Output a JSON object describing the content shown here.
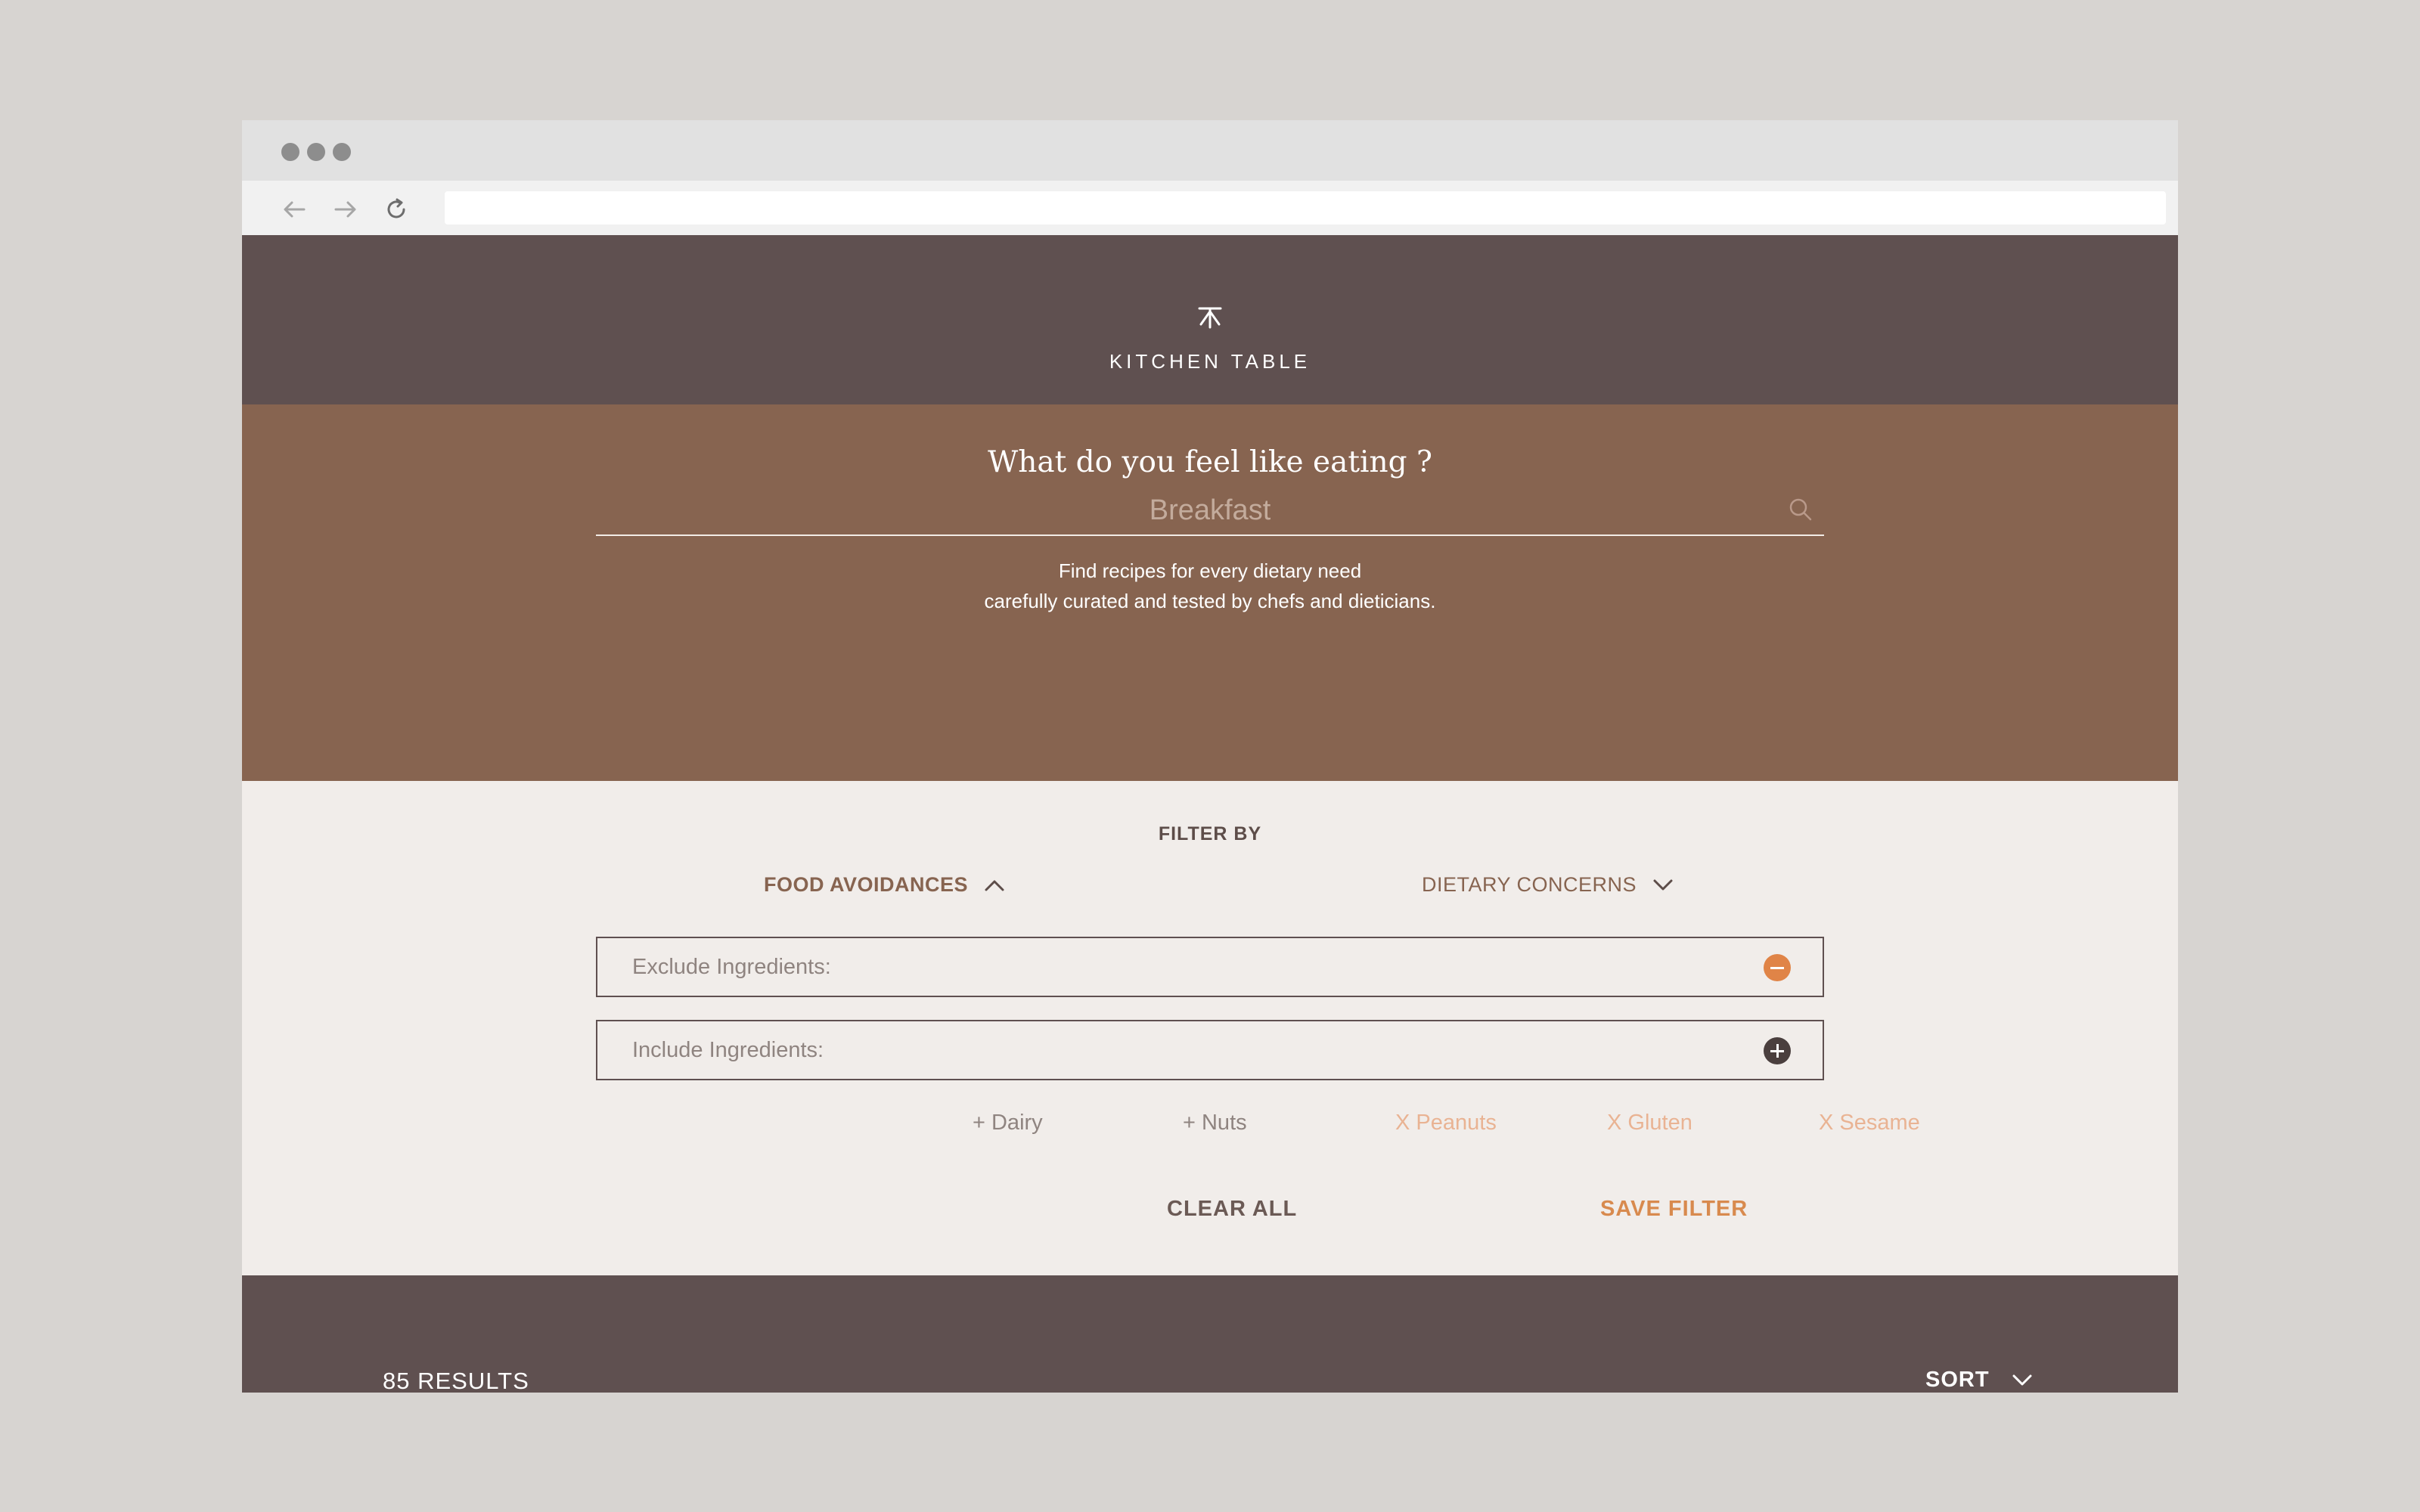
{
  "browser": {
    "back_icon": "arrow-left-icon",
    "forward_icon": "arrow-right-icon",
    "reload_icon": "reload-icon",
    "url": ""
  },
  "header": {
    "logo_icon": "kitchen-table-logo-icon",
    "brand": "KITCHEN TABLE"
  },
  "hero": {
    "title": "What do you feel like eating ?",
    "search_placeholder": "Breakfast",
    "search_icon": "search-icon",
    "subtitle_line1": "Find recipes for every dietary need",
    "subtitle_line2": "carefully curated and tested by chefs and dieticians."
  },
  "filter": {
    "title": "FILTER BY",
    "tabs": [
      {
        "label": "FOOD AVOIDANCES",
        "expanded": true,
        "icon": "chevron-up-icon"
      },
      {
        "label": "DIETARY CONCERNS",
        "expanded": false,
        "icon": "chevron-down-icon"
      }
    ],
    "exclude_placeholder": "Exclude Ingredients:",
    "include_placeholder": "Include Ingredients:",
    "chips": [
      {
        "label": "+ Dairy",
        "kind": "include"
      },
      {
        "label": "+ Nuts",
        "kind": "include"
      },
      {
        "label": "X Peanuts",
        "kind": "exclude"
      },
      {
        "label": "X Gluten",
        "kind": "exclude"
      },
      {
        "label": "X Sesame",
        "kind": "exclude"
      }
    ],
    "clear_label": "CLEAR ALL",
    "save_label": "SAVE FILTER"
  },
  "results": {
    "count_label": "85 RESULTS",
    "sort_label": "SORT",
    "sort_icon": "chevron-down-icon"
  },
  "colors": {
    "header_bg": "#5f5050",
    "hero_bg": "#876450",
    "filter_bg": "#f1edea",
    "accent_orange": "#e08447",
    "exclude_chip": "#e9b393"
  }
}
